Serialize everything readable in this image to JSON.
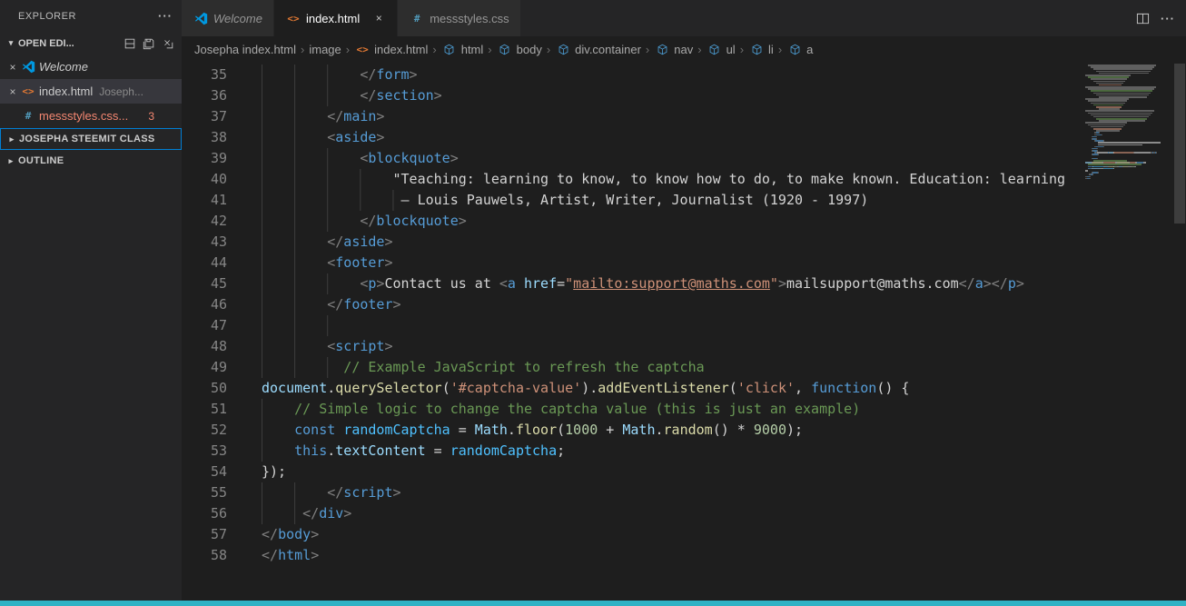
{
  "colors": {
    "accent": "#007fd4",
    "status_bar": "#2fb2c4",
    "error_file": "#f48771",
    "html_icon": "#e37933",
    "css_icon": "#519aba",
    "vscode_icon": "#0098e0",
    "symbol_icon": "#4d9fd6",
    "token": {
      "p": "#808080",
      "t": "#569cd6",
      "a": "#9cdcfe",
      "s": "#ce9178",
      "sl": "#ce9178",
      "c": "#6a9955",
      "k": "#569cd6",
      "f": "#dcdcaa",
      "v": "#9cdcfe",
      "cv": "#4fc1ff",
      "n": "#b5cea8",
      "d": "#d4d4d4"
    }
  },
  "icons": {
    "close": "×",
    "more": "···",
    "chevron_down": "▾",
    "chevron_right": "▸",
    "breadcrumb_separator": "›"
  },
  "explorer": {
    "title": "EXPLORER",
    "open_editors": {
      "label": "OPEN EDI...",
      "actions": [
        "toggle-vertical-layout",
        "save-all",
        "close-all"
      ],
      "items": [
        {
          "close": "×",
          "icon": "vscode",
          "label": "Welcome",
          "desc": "",
          "preview": true,
          "selected": false,
          "error": false,
          "badge": ""
        },
        {
          "close": "×",
          "icon": "html",
          "label": "index.html",
          "desc": "Joseph...",
          "preview": false,
          "selected": true,
          "error": false,
          "badge": ""
        },
        {
          "close": "",
          "icon": "css",
          "label": "messstyles.css...",
          "desc": "",
          "preview": false,
          "selected": false,
          "error": true,
          "badge": "3"
        }
      ]
    },
    "sections": [
      {
        "label": "JOSEPHA STEEMIT CLASS",
        "focused": true
      },
      {
        "label": "OUTLINE",
        "focused": false
      }
    ]
  },
  "tabs": [
    {
      "label": "Welcome",
      "icon": "vscode",
      "italic": true,
      "active": false,
      "show_close": false
    },
    {
      "label": "index.html",
      "icon": "html",
      "italic": false,
      "active": true,
      "show_close": true
    },
    {
      "label": "messstyles.css",
      "icon": "css",
      "italic": false,
      "active": false,
      "show_close": false
    }
  ],
  "breadcrumbs": [
    {
      "label": "Josepha index.html",
      "icon": ""
    },
    {
      "label": "image",
      "icon": ""
    },
    {
      "label": "index.html",
      "icon": "html"
    },
    {
      "label": "html",
      "icon": "cube"
    },
    {
      "label": "body",
      "icon": "cube"
    },
    {
      "label": "div.container",
      "icon": "cube"
    },
    {
      "label": "nav",
      "icon": "cube"
    },
    {
      "label": "ul",
      "icon": "cube"
    },
    {
      "label": "li",
      "icon": "cube"
    },
    {
      "label": "a",
      "icon": "cube"
    }
  ],
  "editor": {
    "total_lines": 58,
    "lines": [
      {
        "n": 35,
        "indent": 12,
        "tokens": [
          [
            "p",
            "</"
          ],
          [
            "t",
            "form"
          ],
          [
            "p",
            ">"
          ]
        ]
      },
      {
        "n": 36,
        "indent": 12,
        "tokens": [
          [
            "p",
            "</"
          ],
          [
            "t",
            "section"
          ],
          [
            "p",
            ">"
          ]
        ]
      },
      {
        "n": 37,
        "indent": 8,
        "tokens": [
          [
            "p",
            "</"
          ],
          [
            "t",
            "main"
          ],
          [
            "p",
            ">"
          ]
        ]
      },
      {
        "n": 38,
        "indent": 8,
        "tokens": [
          [
            "p",
            "<"
          ],
          [
            "t",
            "aside"
          ],
          [
            "p",
            ">"
          ]
        ]
      },
      {
        "n": 39,
        "indent": 12,
        "tokens": [
          [
            "p",
            "<"
          ],
          [
            "t",
            "blockquote"
          ],
          [
            "p",
            ">"
          ]
        ]
      },
      {
        "n": 40,
        "indent": 16,
        "tokens": [
          [
            "d",
            "\"Teaching: learning to know, to know how to do, to make known. Education: learning"
          ]
        ]
      },
      {
        "n": 41,
        "indent": 17,
        "tokens": [
          [
            "d",
            "— Louis Pauwels, Artist, Writer, Journalist (1920 - 1997)"
          ]
        ]
      },
      {
        "n": 42,
        "indent": 12,
        "tokens": [
          [
            "p",
            "</"
          ],
          [
            "t",
            "blockquote"
          ],
          [
            "p",
            ">"
          ]
        ]
      },
      {
        "n": 43,
        "indent": 8,
        "tokens": [
          [
            "p",
            "</"
          ],
          [
            "t",
            "aside"
          ],
          [
            "p",
            ">"
          ]
        ]
      },
      {
        "n": 44,
        "indent": 8,
        "tokens": [
          [
            "p",
            "<"
          ],
          [
            "t",
            "footer"
          ],
          [
            "p",
            ">"
          ]
        ]
      },
      {
        "n": 45,
        "indent": 12,
        "tokens": [
          [
            "p",
            "<"
          ],
          [
            "t",
            "p"
          ],
          [
            "p",
            ">"
          ],
          [
            "d",
            "Contact us at "
          ],
          [
            "p",
            "<"
          ],
          [
            "t",
            "a"
          ],
          [
            "d",
            " "
          ],
          [
            "a",
            "href"
          ],
          [
            "d",
            "="
          ],
          [
            "s",
            "\""
          ],
          [
            "sl",
            "mailto:support@maths.com"
          ],
          [
            "s",
            "\""
          ],
          [
            "p",
            ">"
          ],
          [
            "d",
            "mailsupport@maths.com"
          ],
          [
            "p",
            "</"
          ],
          [
            "t",
            "a"
          ],
          [
            "p",
            ">"
          ],
          [
            "p",
            "</"
          ],
          [
            "t",
            "p"
          ],
          [
            "p",
            ">"
          ]
        ]
      },
      {
        "n": 46,
        "indent": 8,
        "tokens": [
          [
            "p",
            "</"
          ],
          [
            "t",
            "footer"
          ],
          [
            "p",
            ">"
          ]
        ]
      },
      {
        "n": 47,
        "indent": 12,
        "tokens": []
      },
      {
        "n": 48,
        "indent": 8,
        "tokens": [
          [
            "p",
            "<"
          ],
          [
            "t",
            "script"
          ],
          [
            "p",
            ">"
          ]
        ]
      },
      {
        "n": 49,
        "indent": 10,
        "tokens": [
          [
            "c",
            "// Example JavaScript to refresh the captcha"
          ]
        ]
      },
      {
        "n": 50,
        "indent": 0,
        "tokens": [
          [
            "v",
            "document"
          ],
          [
            "d",
            "."
          ],
          [
            "f",
            "querySelector"
          ],
          [
            "d",
            "("
          ],
          [
            "s",
            "'#captcha-value'"
          ],
          [
            "d",
            ")."
          ],
          [
            "f",
            "addEventListener"
          ],
          [
            "d",
            "("
          ],
          [
            "s",
            "'click'"
          ],
          [
            "d",
            ", "
          ],
          [
            "k",
            "function"
          ],
          [
            "d",
            "() {"
          ]
        ]
      },
      {
        "n": 51,
        "indent": 4,
        "tokens": [
          [
            "c",
            "// Simple logic to change the captcha value (this is just an example)"
          ]
        ]
      },
      {
        "n": 52,
        "indent": 4,
        "tokens": [
          [
            "k",
            "const"
          ],
          [
            "d",
            " "
          ],
          [
            "cv",
            "randomCaptcha"
          ],
          [
            "d",
            " = "
          ],
          [
            "v",
            "Math"
          ],
          [
            "d",
            "."
          ],
          [
            "f",
            "floor"
          ],
          [
            "d",
            "("
          ],
          [
            "n",
            "1000"
          ],
          [
            "d",
            " + "
          ],
          [
            "v",
            "Math"
          ],
          [
            "d",
            "."
          ],
          [
            "f",
            "random"
          ],
          [
            "d",
            "() * "
          ],
          [
            "n",
            "9000"
          ],
          [
            "d",
            ");"
          ]
        ]
      },
      {
        "n": 53,
        "indent": 4,
        "tokens": [
          [
            "k",
            "this"
          ],
          [
            "d",
            "."
          ],
          [
            "v",
            "textContent"
          ],
          [
            "d",
            " = "
          ],
          [
            "cv",
            "randomCaptcha"
          ],
          [
            "d",
            ";"
          ]
        ]
      },
      {
        "n": 54,
        "indent": 0,
        "tokens": [
          [
            "d",
            "});"
          ]
        ]
      },
      {
        "n": 55,
        "indent": 8,
        "tokens": [
          [
            "p",
            "</"
          ],
          [
            "t",
            "script"
          ],
          [
            "p",
            ">"
          ]
        ]
      },
      {
        "n": 56,
        "indent": 5,
        "tokens": [
          [
            "p",
            "</"
          ],
          [
            "t",
            "div"
          ],
          [
            "p",
            ">"
          ]
        ]
      },
      {
        "n": 57,
        "indent": 0,
        "tokens": [
          [
            "p",
            "</"
          ],
          [
            "t",
            "body"
          ],
          [
            "p",
            ">"
          ]
        ]
      },
      {
        "n": 58,
        "indent": 0,
        "tokens": [
          [
            "p",
            "</"
          ],
          [
            "t",
            "html"
          ],
          [
            "p",
            ">"
          ]
        ]
      }
    ]
  }
}
